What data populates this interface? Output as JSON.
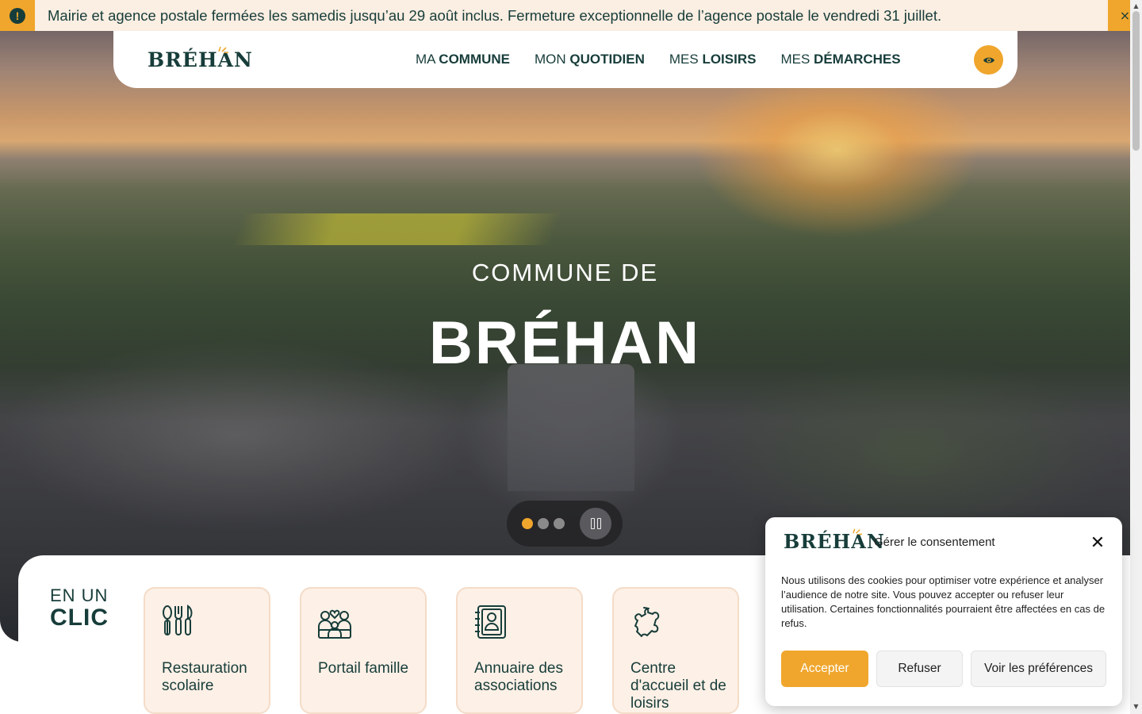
{
  "alert": {
    "text": "Mairie et agence postale fermées les samedis jusqu’au 29 août inclus. Fermeture exceptionnelle de l’agence postale le vendredi 31 juillet.",
    "icon": "exclamation-icon",
    "close_label": "×"
  },
  "header": {
    "logo": "BRÉHAN",
    "nav": [
      {
        "prefix": "MA",
        "strong": "COMMUNE"
      },
      {
        "prefix": "MON",
        "strong": "QUOTIDIEN"
      },
      {
        "prefix": "MES",
        "strong": "LOISIRS"
      },
      {
        "prefix": "MES",
        "strong": "DÉMARCHES"
      }
    ],
    "accessibility_icon": "eye-icon"
  },
  "hero": {
    "subtitle": "COMMUNE DE",
    "title": "BRÉHAN",
    "slides_total": 3,
    "active_slide": 1
  },
  "clic": {
    "title_line1": "EN UN",
    "title_line2": "CLIC",
    "cards": [
      {
        "label": "Restauration scolaire",
        "icon": "cutlery-icon"
      },
      {
        "label": "Portail famille",
        "icon": "family-icon"
      },
      {
        "label": "Annuaire des associations",
        "icon": "directory-icon"
      },
      {
        "label": "Centre d'accueil et de loisirs",
        "icon": "puzzle-icon"
      }
    ]
  },
  "cookie": {
    "logo": "BRÉHAN",
    "title": "Gérer le consentement",
    "text": "Nous utilisons des cookies pour optimiser votre expérience et analyser l’audience de notre site. Vous pouvez accepter ou refuser leur utilisation. Certaines fonctionnalités pourraient être affectées en cas de refus.",
    "accept": "Accepter",
    "refuse": "Refuser",
    "prefs": "Voir les préférences",
    "close": "✕"
  },
  "colors": {
    "accent": "#f0a62c",
    "primary": "#173d3a",
    "card_bg": "#fdf0e6",
    "alert_bg": "#fbeee2"
  }
}
